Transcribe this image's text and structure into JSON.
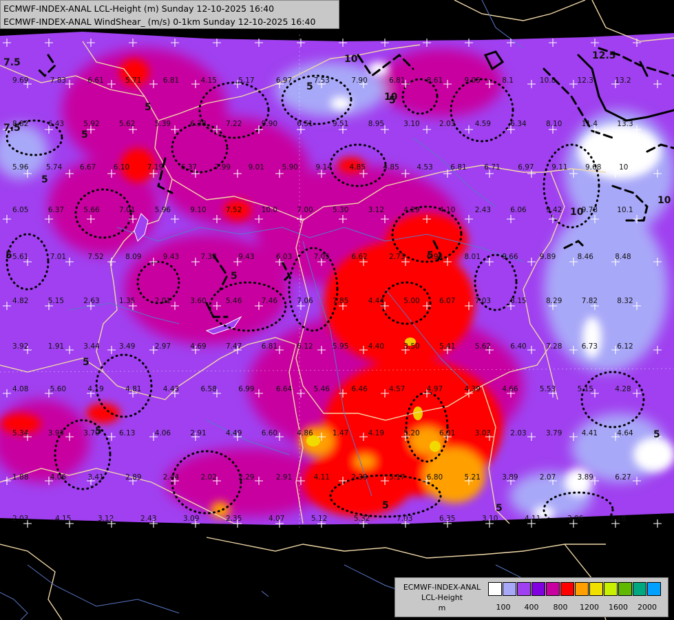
{
  "title": {
    "line1": "ECMWF-INDEX-ANAL LCL-Height (m) Sunday 12-10-2025 16:40",
    "line2": "ECMWF-INDEX-ANAL WindShear_ (m/s) 0-1km Sunday 12-10-2025 16:40"
  },
  "legend": {
    "line1": "ECMWF-INDEX-ANAL",
    "line2": "LCL-Height",
    "line3": "m",
    "colors": [
      "#ffffff",
      "#a8a8f8",
      "#a040f0",
      "#8000e0",
      "#c800a0",
      "#ff0000",
      "#ffa000",
      "#f0e000",
      "#c8f000",
      "#60b800",
      "#00a880",
      "#00a0ff"
    ],
    "ticks": [
      "100",
      "400",
      "800",
      "1200",
      "1600",
      "2000"
    ]
  },
  "contour_labels": [
    "7.5",
    "5",
    "10",
    "12.5",
    "10",
    "5",
    "7.5",
    "5",
    "10",
    "10",
    "5",
    "5",
    "5",
    "5",
    "5",
    "5",
    "5",
    "5",
    "5",
    "5"
  ],
  "shear_values": [
    "9.69",
    "7.83",
    "6.61",
    "5.71",
    "6.81",
    "4.15",
    "5.17",
    "6.97",
    "7.53",
    "7.90",
    "6.81",
    "8.61",
    "9.05",
    "8.1",
    "10.8",
    "12.3",
    "13.2",
    "8.82",
    "6.43",
    "5.92",
    "5.62",
    "5.39",
    "6.38",
    "7.22",
    "9.90",
    "6.51",
    "9.51",
    "8.95",
    "3.10",
    "2.03",
    "4.59",
    "6.34",
    "8.10",
    "11.4",
    "13.3",
    "5.96",
    "5.74",
    "6.67",
    "6.10",
    "7.19",
    "6.37",
    "7.99",
    "9.01",
    "5.90",
    "9.14",
    "4.85",
    "4.85",
    "4.53",
    "6.81",
    "6.71",
    "6.97",
    "9.11",
    "9.68",
    "10",
    "6.05",
    "6.37",
    "5.66",
    "7.01",
    "5.96",
    "9.10",
    "7.52",
    "10.0",
    "7.00",
    "5.30",
    "3.12",
    "4.29",
    "4.10",
    "2.43",
    "6.06",
    "9.42",
    "9.78",
    "10.1",
    "5.61",
    "7.01",
    "7.52",
    "8.09",
    "9.43",
    "7.38",
    "9.43",
    "6.03",
    "7.05",
    "6.62",
    "2.73",
    "6.95",
    "8.01",
    "9.66",
    "9.89",
    "8.46",
    "8.48",
    "4.82",
    "5.15",
    "2.63",
    "1.35",
    "2.01",
    "3.60",
    "5.46",
    "7.46",
    "7.06",
    "7.85",
    "4.44",
    "5.00",
    "6.07",
    "7.03",
    "8.15",
    "8.29",
    "7.82",
    "8.32",
    "3.92",
    "1.91",
    "3.44",
    "3.49",
    "2.97",
    "4.69",
    "7.47",
    "6.81",
    "6.12",
    "5.95",
    "4.40",
    "3.50",
    "5.41",
    "5.62",
    "6.40",
    "7.28",
    "6.73",
    "6.12",
    "4.08",
    "5.60",
    "4.19",
    "4.81",
    "4.43",
    "6.58",
    "6.99",
    "6.64",
    "5.46",
    "6.46",
    "4.57",
    "4.97",
    "4.39",
    "4.66",
    "5.53",
    "5.15",
    "4.28",
    "5.34",
    "3.93",
    "3.70",
    "6.13",
    "4.06",
    "2.91",
    "4.49",
    "6.60",
    "4.86",
    "1.47",
    "4.19",
    "5.20",
    "6.01",
    "3.03",
    "2.03",
    "3.79",
    "4.41",
    "4.64",
    "1.88",
    "4.06",
    "3.41",
    "2.89",
    "2.44",
    "2.02",
    "2.29",
    "2.91",
    "4.11",
    "2.39",
    "5.17",
    "6.80",
    "5.21",
    "3.89",
    "2.07",
    "3.89",
    "6.27",
    "2.03",
    "4.15",
    "3.12",
    "2.43",
    "3.09",
    "2.35",
    "4.07",
    "5.12",
    "5.32",
    "7.03",
    "6.35",
    "3.10",
    "4.11",
    "3.06",
    "2.28"
  ]
}
